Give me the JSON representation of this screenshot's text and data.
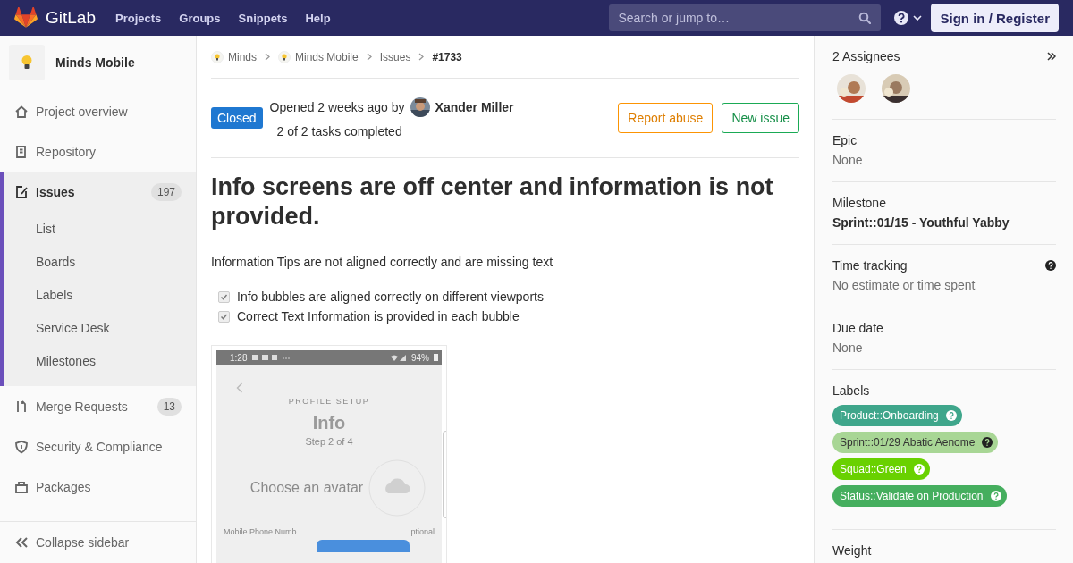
{
  "header": {
    "brand": "GitLab",
    "nav": [
      {
        "label": "Projects"
      },
      {
        "label": "Groups"
      },
      {
        "label": "Snippets"
      },
      {
        "label": "Help"
      }
    ],
    "search": {
      "placeholder": "Search or jump to…"
    },
    "sign_in": "Sign in / Register"
  },
  "sidebar": {
    "project": "Minds Mobile",
    "items": [
      {
        "label": "Project overview",
        "selected": false
      },
      {
        "label": "Repository",
        "selected": false
      },
      {
        "label": "Issues",
        "count": "197",
        "selected": true,
        "children": [
          {
            "label": "List",
            "selected": false
          },
          {
            "label": "Boards",
            "selected": false
          },
          {
            "label": "Labels",
            "selected": false
          },
          {
            "label": "Service Desk",
            "selected": false
          },
          {
            "label": "Milestones",
            "selected": false
          }
        ]
      },
      {
        "label": "Merge Requests",
        "count": "13",
        "selected": false
      },
      {
        "label": "Security & Compliance",
        "selected": false
      },
      {
        "label": "Packages",
        "selected": false
      }
    ],
    "collapse": "Collapse sidebar"
  },
  "breadcrumbs": [
    {
      "label": "Minds",
      "kind": "group"
    },
    {
      "label": "Minds Mobile",
      "kind": "group"
    },
    {
      "label": "Issues",
      "kind": "link"
    },
    {
      "label": "#1733",
      "kind": "current"
    }
  ],
  "issue": {
    "status": "Closed",
    "opened": "Opened 2 weeks ago by",
    "author": "Xander Miller",
    "tasks_summary": "2 of 2 tasks completed",
    "buttons": [
      {
        "label": "Report abuse",
        "kind": "warning"
      },
      {
        "label": "New issue",
        "kind": "success"
      }
    ],
    "title": "Info screens are off center and information is not provided.",
    "description": "Information Tips are not aligned correctly and are missing text",
    "tasks": [
      {
        "label": "Info bubbles are aligned correctly on different viewports",
        "checked": true
      },
      {
        "label": "Correct Text Information is provided in each bubble",
        "checked": true
      }
    ],
    "attachment": {
      "time": "1:28",
      "battery": "94%",
      "eyebrow": "PROFILE SETUP",
      "heading": "Info",
      "step": "Step 2 of 4",
      "avatar_prompt": "Choose an avatar",
      "field_label": "Mobile Phone Numb",
      "field_hint": "ptional"
    }
  },
  "right": {
    "assignees": {
      "title": "2 Assignees"
    },
    "sections": [
      {
        "kind": "value",
        "title": "Epic",
        "value": "None"
      },
      {
        "kind": "bold",
        "title": "Milestone",
        "value": "Sprint::01/15 - Youthful Yabby"
      },
      {
        "kind": "help",
        "title": "Time tracking",
        "value": "No estimate or time spent"
      },
      {
        "kind": "value",
        "title": "Due date",
        "value": "None"
      },
      {
        "kind": "labels",
        "title": "Labels",
        "labels": [
          {
            "label": "Product::Onboarding",
            "color": "#3fa68b"
          },
          {
            "label": "Sprint::01/29 Abatic Aenome",
            "color": "#a8d695"
          },
          {
            "label": "Squad::Green",
            "color": "#69d100"
          },
          {
            "label": "Status::Validate on Production",
            "color": "#45ae5e"
          }
        ]
      },
      {
        "kind": "title",
        "title": "Weight"
      }
    ]
  }
}
